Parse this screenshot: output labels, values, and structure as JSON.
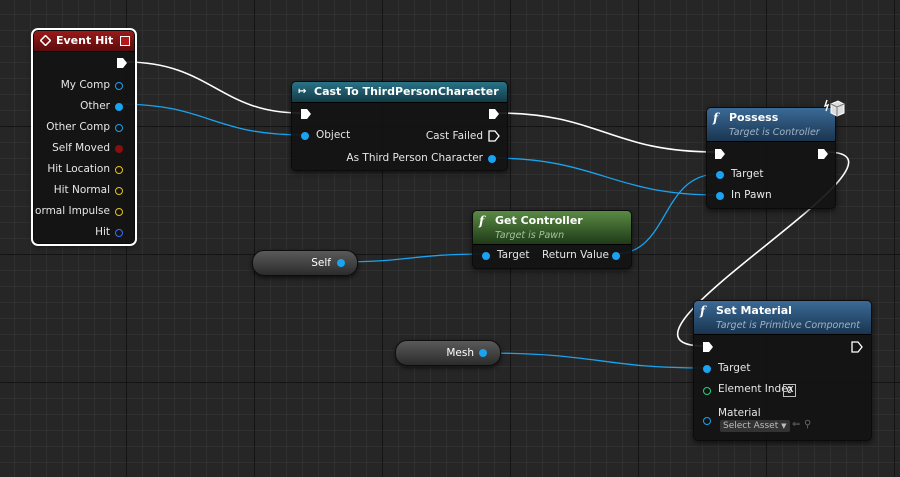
{
  "event_hit": {
    "title": "Event Hit",
    "pins": [
      "My Comp",
      "Other",
      "Other Comp",
      "Self Moved",
      "Hit Location",
      "Hit Normal",
      "Normal Impulse",
      "Hit"
    ]
  },
  "cast": {
    "title": "Cast To ThirdPersonCharacter",
    "object_label": "Object",
    "failed_label": "Cast Failed",
    "result_label": "As Third Person Character"
  },
  "possess": {
    "title": "Possess",
    "subtitle": "Target is Controller",
    "target_label": "Target",
    "pawn_label": "In Pawn"
  },
  "get_controller": {
    "title": "Get Controller",
    "subtitle": "Target is Pawn",
    "target_label": "Target",
    "return_label": "Return Value"
  },
  "self_node": {
    "label": "Self"
  },
  "mesh_node": {
    "label": "Mesh"
  },
  "set_material": {
    "title": "Set Material",
    "subtitle": "Target is Primitive Component",
    "target_label": "Target",
    "element_index_label": "Element Index",
    "element_index_value": "0",
    "material_label": "Material",
    "select_asset_label": "Select Asset"
  },
  "colors": {
    "event_header": "#7a1414",
    "cast_header": "#1e5a6b",
    "possess_header": "#2b4f73",
    "get_controller_header": "#3f6b2e",
    "set_material_header": "#2b4f73",
    "object_pin": "#1aa3f0",
    "exec_wire": "#ffffff"
  },
  "icons": {
    "event": "event-diamond-icon",
    "cast": "cast-arrow-icon",
    "function": "function-f-icon",
    "network": "network-cube-icon"
  }
}
